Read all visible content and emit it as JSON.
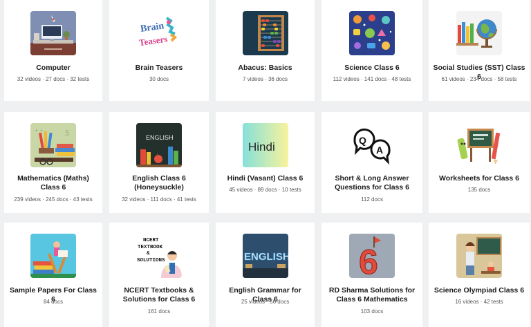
{
  "cards": [
    {
      "title": "Computer",
      "meta": "32 videos · 27 docs · 32 tests",
      "icon": "computer-desk-icon"
    },
    {
      "title": "Brain Teasers",
      "meta": "30 docs",
      "icon": "brain-teasers-logo-icon",
      "logo_text": [
        "Brain",
        "Teasers"
      ]
    },
    {
      "title": "Abacus: Basics",
      "meta": "7 videos · 36 docs",
      "icon": "abacus-icon"
    },
    {
      "title": "Science Class 6",
      "meta": "112 videos · 141 docs · 48 tests",
      "icon": "science-stickers-icon"
    },
    {
      "title": "Social Studies (SST) Class 6",
      "meta": "61 videos · 234 docs · 58 tests",
      "icon": "globe-icon"
    },
    {
      "title": "Mathematics (Maths) Class 6",
      "meta": "239 videos · 245 docs · 43 tests",
      "icon": "math-books-icon"
    },
    {
      "title": "English Class 6 (Honeysuckle)",
      "meta": "32 videos · 111 docs · 41 tests",
      "icon": "english-blackboard-icon",
      "art_text": "ENGLISH"
    },
    {
      "title": "Hindi (Vasant) Class 6",
      "meta": "45 videos · 89 docs · 10 tests",
      "icon": "hindi-text-icon",
      "art_text": "Hindi"
    },
    {
      "title": "Short & Long Answer Questions for Class 6",
      "meta": "112 docs",
      "icon": "qa-bubbles-icon",
      "art_text": [
        "Q",
        "A"
      ]
    },
    {
      "title": "Worksheets for Class 6",
      "meta": "135 docs",
      "icon": "worksheets-board-icon"
    },
    {
      "title": "Sample Papers For Class 6",
      "meta": "84 docs",
      "icon": "sample-papers-books-icon"
    },
    {
      "title": "NCERT Textbooks & Solutions for Class 6",
      "meta": "161 docs",
      "icon": "ncert-solutions-icon",
      "art_text": [
        "NCERT",
        "TEXTBOOK",
        "&",
        "SOLUTIONS"
      ]
    },
    {
      "title": "English Grammar for Class 6",
      "meta": "25 videos · 56 docs",
      "icon": "english-letters-icon",
      "art_text": "ENGLISH"
    },
    {
      "title": "RD Sharma Solutions for Class 6 Mathematics",
      "meta": "103 docs",
      "icon": "number-six-icon",
      "art_text": "6"
    },
    {
      "title": "Science Olympiad Class 6",
      "meta": "16 videos · 42 tests",
      "icon": "teacher-classroom-icon"
    }
  ]
}
